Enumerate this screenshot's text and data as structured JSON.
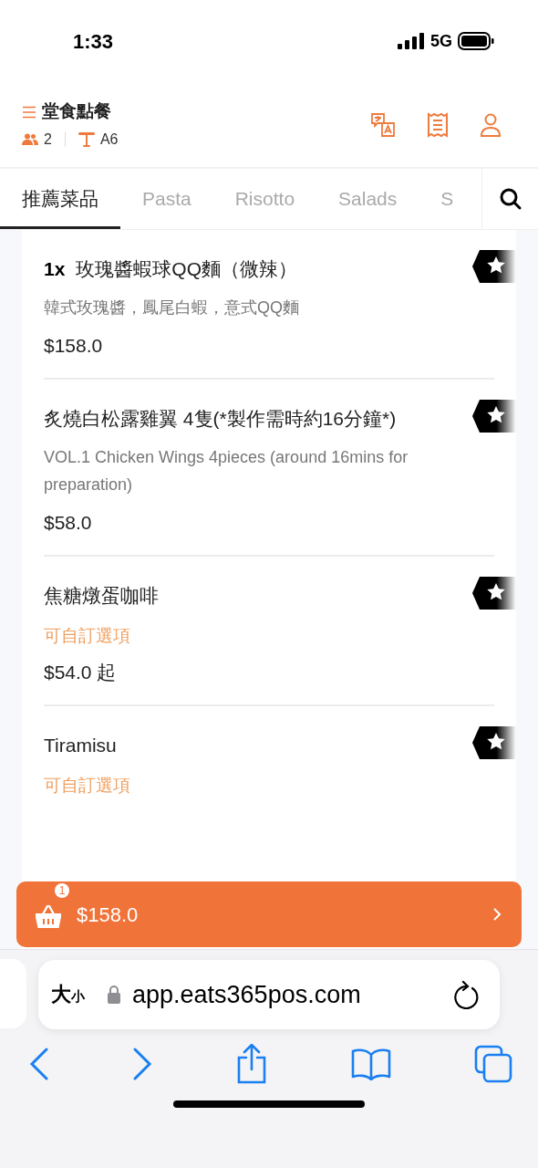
{
  "status_bar": {
    "time": "1:33",
    "network": "5G"
  },
  "header": {
    "title": "堂食點餐",
    "guests": "2",
    "table": "A6"
  },
  "tabs": [
    {
      "label": "推薦菜品",
      "selected": true
    },
    {
      "label": "Pasta",
      "selected": false
    },
    {
      "label": "Risotto",
      "selected": false
    },
    {
      "label": "Salads",
      "selected": false
    },
    {
      "label": "S",
      "selected": false
    }
  ],
  "menu_items": [
    {
      "quantity": "1x",
      "name": "玫瑰醬蝦球QQ麵（微辣）",
      "description": "韓式玫瑰醬，鳳尾白蝦，意式QQ麵",
      "price": "$158.0",
      "recommended": true
    },
    {
      "name": "炙燒白松露雞翼 4隻(*製作需時約16分鐘*)",
      "description": "VOL.1 Chicken Wings 4pieces (around 16mins for preparation)",
      "price": "$58.0",
      "recommended": true
    },
    {
      "name": "焦糖燉蛋咖啡",
      "options": "可自訂選項",
      "price": "$54.0 起",
      "recommended": true
    },
    {
      "name": "Tiramisu",
      "options": "可自訂選項",
      "recommended": true
    }
  ],
  "cart": {
    "count": "1",
    "total": "$158.0"
  },
  "browser": {
    "text_size_large": "大",
    "text_size_small": "小",
    "url": "app.eats365pos.com"
  }
}
